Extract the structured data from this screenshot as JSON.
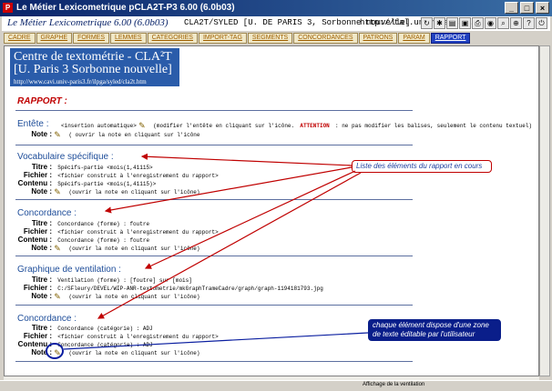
{
  "window": {
    "title": "Le Métier Lexicometrique pCLA2T-P3 6.00 (6.0b03)",
    "app_icon": "app-logo-icon",
    "buttons": [
      "_",
      "□",
      "×"
    ]
  },
  "header": {
    "app_name": "Le Métier Lexicometrique 6.00 (6.0b03)",
    "context": "CLA2T/SYLED [U. DE PARIS 3, Sorbonne nouvelle]",
    "url": "http://tal.univ-paris3.fr"
  },
  "tabs": [
    "CADRE",
    "GRAPHE",
    "FORMES",
    "LEMMES",
    "CATEGORIES",
    "IMPORT-TAG",
    "SEGMENTS",
    "CONCORDANCES",
    "PATRONS",
    "PARAM",
    "RAPPORT"
  ],
  "active_tab": "RAPPORT",
  "banner": {
    "line1": "Centre de textométrie - CLA²T",
    "line2": "[U. Paris 3 Sorbonne nouvelle]",
    "url": "http://www.cavi.univ-paris3.fr/ilpga/syled/cla2t.htm"
  },
  "rapport_title": "RAPPORT :",
  "sections": {
    "entete": {
      "title": "Entête :",
      "row1_val": "<insertion automatique>",
      "row1_suffix": "(modifier l'entête en cliquant sur l'icône.",
      "attention": "ATTENTION",
      "row1_tail": ": ne pas modifier les balises, seulement le contenu textuel)",
      "note_label": "Note :",
      "note_val": "( ouvrir la note en cliquant sur l'icône"
    },
    "vocab": {
      "title": "Vocabulaire spécifique :",
      "titre_label": "Titre :",
      "titre_val": "Spécifs-partie <mois(1,41115>",
      "fichier_label": "Fichier :",
      "fichier_val": "<fichier construit à l'enregistrement du rapport>",
      "contenu_label": "Contenu :",
      "contenu_val": "Spécifs-partie <mois(1,41115)>",
      "note_label": "Note :",
      "note_val": "(ouvrir la note en cliquant sur l'icône)"
    },
    "conc1": {
      "title": "Concordance :",
      "titre_label": "Titre :",
      "titre_val": "Concordance (forme) : foutre",
      "fichier_label": "Fichier :",
      "fichier_val": "<fichier construit à l'enregistrement du rapport>",
      "contenu_label": "Contenu :",
      "contenu_val": "Concordance (forme) : foutre",
      "note_label": "Note :",
      "note_val": "(ouvrir la note en cliquant sur l'icône)"
    },
    "graph": {
      "title": "Graphique de ventilation :",
      "titre_label": "Titre :",
      "titre_val": "Ventilation (forme) : [foutre] sur [mois]",
      "fichier_label": "Fichier :",
      "fichier_val": "C:/SFleury/DEVEL/WIP-ANR-textometrie/mkGraphTrameCadre/graph/graph-1194181793.jpg",
      "note_label": "Note :",
      "note_val": "(ouvrir la note en cliquant sur l'icône)"
    },
    "conc2": {
      "title": "Concordance :",
      "titre_label": "Titre :",
      "titre_val": "Concordance (catégorie) : ADJ",
      "fichier_label": "Fichier :",
      "fichier_val": "<fichier construit à l'enregistrement du rapport>",
      "contenu_label": "Contenu :",
      "contenu_val": "Concordance (catégorie) : ADJ",
      "note_label": "Note :",
      "note_val": "(ouvrir la note en cliquant sur l'icône)"
    }
  },
  "callouts": {
    "list": "Liste des éléments du rapport en cours",
    "editable": "chaque élément dispose d'une zone de texte éditable par l'utilisateur"
  },
  "status": "Affichage de la ventilation",
  "colors": {
    "titlebar": "#0a246a",
    "active_tab": "#2040c0",
    "section_title": "#1f4e9a",
    "rapport": "#c00000"
  }
}
